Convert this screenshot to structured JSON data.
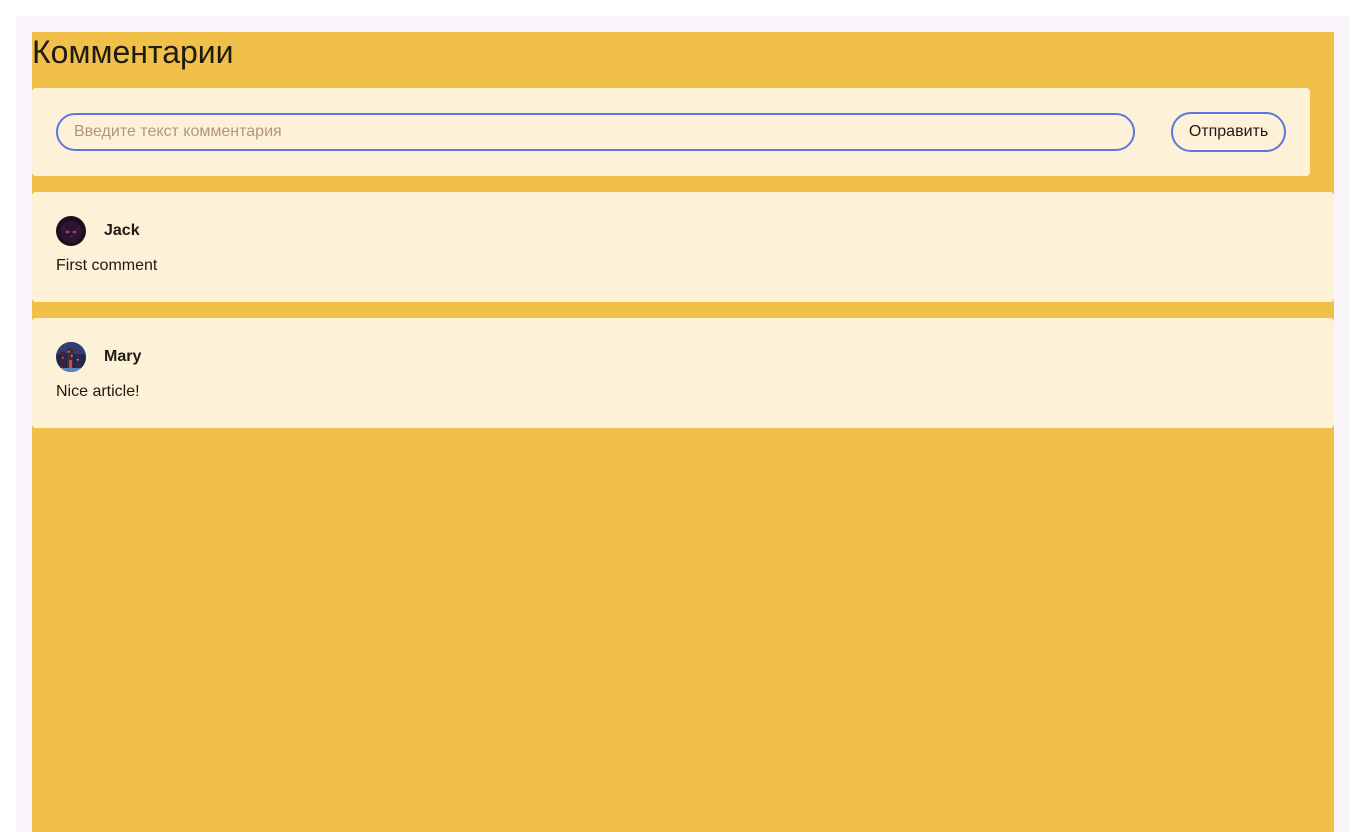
{
  "page": {
    "title": "Комментарии"
  },
  "form": {
    "input_placeholder": "Введите текст комментария",
    "input_value": "",
    "submit_label": "Отправить"
  },
  "comments": [
    {
      "author": "Jack",
      "text": "First comment",
      "avatar_icon": "dark-cat-avatar-icon"
    },
    {
      "author": "Mary",
      "text": "Nice article!",
      "avatar_icon": "night-city-avatar-icon"
    }
  ],
  "colors": {
    "page_background": "#faf5fb",
    "panel_background": "#f0c049",
    "card_background": "#fdf2d7",
    "accent_border": "#5a78e0",
    "text": "#1e1a14"
  }
}
